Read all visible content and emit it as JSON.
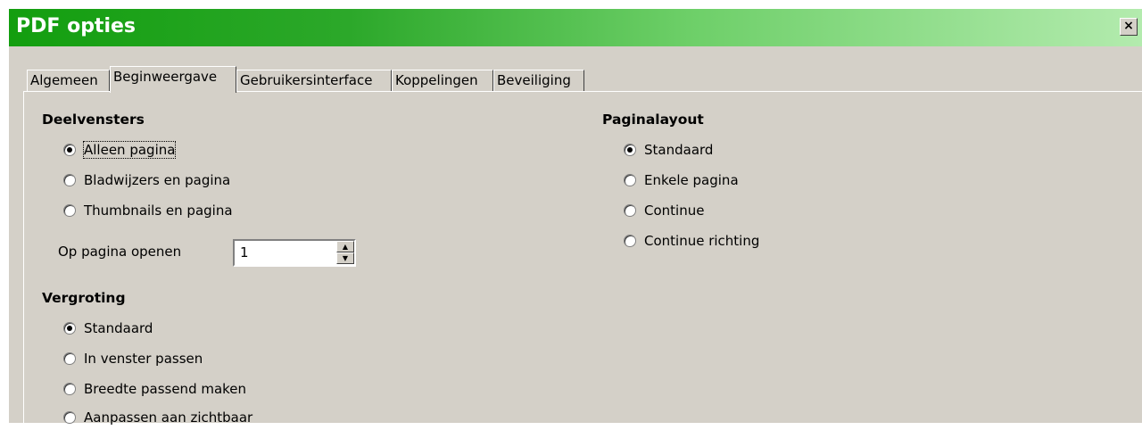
{
  "window": {
    "title": "PDF opties",
    "close_label": "×"
  },
  "tabs": [
    {
      "label": "Algemeen",
      "active": false
    },
    {
      "label": "Beginweergave",
      "active": true
    },
    {
      "label": "Gebruikersinterface",
      "active": false
    },
    {
      "label": "Koppelingen",
      "active": false
    },
    {
      "label": "Beveiliging",
      "active": false
    }
  ],
  "deelvensters": {
    "title": "Deelvensters",
    "options": [
      {
        "label": "Alleen pagina",
        "checked": true
      },
      {
        "label": "Bladwijzers en pagina",
        "checked": false
      },
      {
        "label": "Thumbnails en pagina",
        "checked": false
      }
    ],
    "open_page_label": "Op pagina openen",
    "open_page_value": "1"
  },
  "vergroting": {
    "title": "Vergroting",
    "options": [
      {
        "label": "Standaard",
        "checked": true
      },
      {
        "label": "In venster passen",
        "checked": false
      },
      {
        "label": "Breedte passend maken",
        "checked": false
      },
      {
        "label": "Aanpassen aan zichtbaar",
        "checked": false
      }
    ]
  },
  "paginalayout": {
    "title": "Paginalayout",
    "options": [
      {
        "label": "Standaard",
        "checked": true
      },
      {
        "label": "Enkele pagina",
        "checked": false
      },
      {
        "label": "Continue",
        "checked": false
      },
      {
        "label": "Continue richting",
        "checked": false
      }
    ]
  },
  "icons": {
    "spin_up": "▲",
    "spin_down": "▼"
  }
}
